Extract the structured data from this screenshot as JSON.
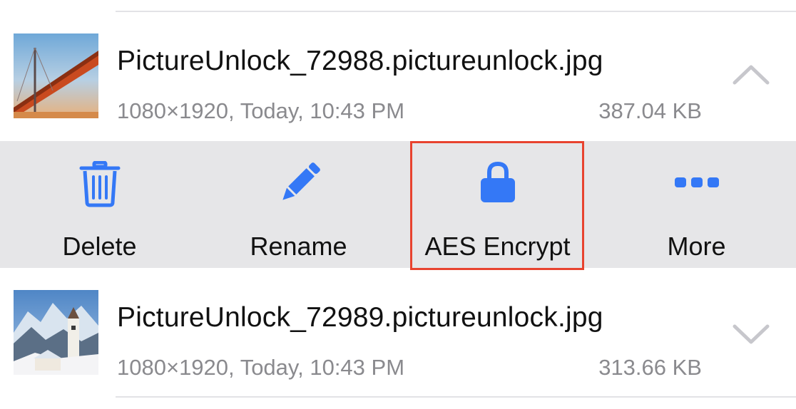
{
  "files": [
    {
      "name": "PictureUnlock_72988.pictureunlock.jpg",
      "meta": "1080×1920, Today, 10:43 PM",
      "size": "387.04 KB",
      "expanded": true,
      "chevron_icon": "chevron-up-icon"
    },
    {
      "name": "PictureUnlock_72989.pictureunlock.jpg",
      "meta": "1080×1920, Today, 10:43 PM",
      "size": "313.66 KB",
      "expanded": false,
      "chevron_icon": "chevron-down-icon"
    }
  ],
  "actions": [
    {
      "id": "delete",
      "label": "Delete",
      "icon": "trash-icon"
    },
    {
      "id": "rename",
      "label": "Rename",
      "icon": "pencil-icon"
    },
    {
      "id": "aes-encrypt",
      "label": "AES Encrypt",
      "icon": "lock-icon",
      "highlighted": true
    },
    {
      "id": "more",
      "label": "More",
      "icon": "ellipsis-icon"
    }
  ],
  "colors": {
    "accent": "#3478f6",
    "action_bar_background": "#e6e6e8",
    "highlight_border": "#e8432f",
    "secondary_text": "#8a8a8e",
    "chevron": "#c7c7cc"
  }
}
